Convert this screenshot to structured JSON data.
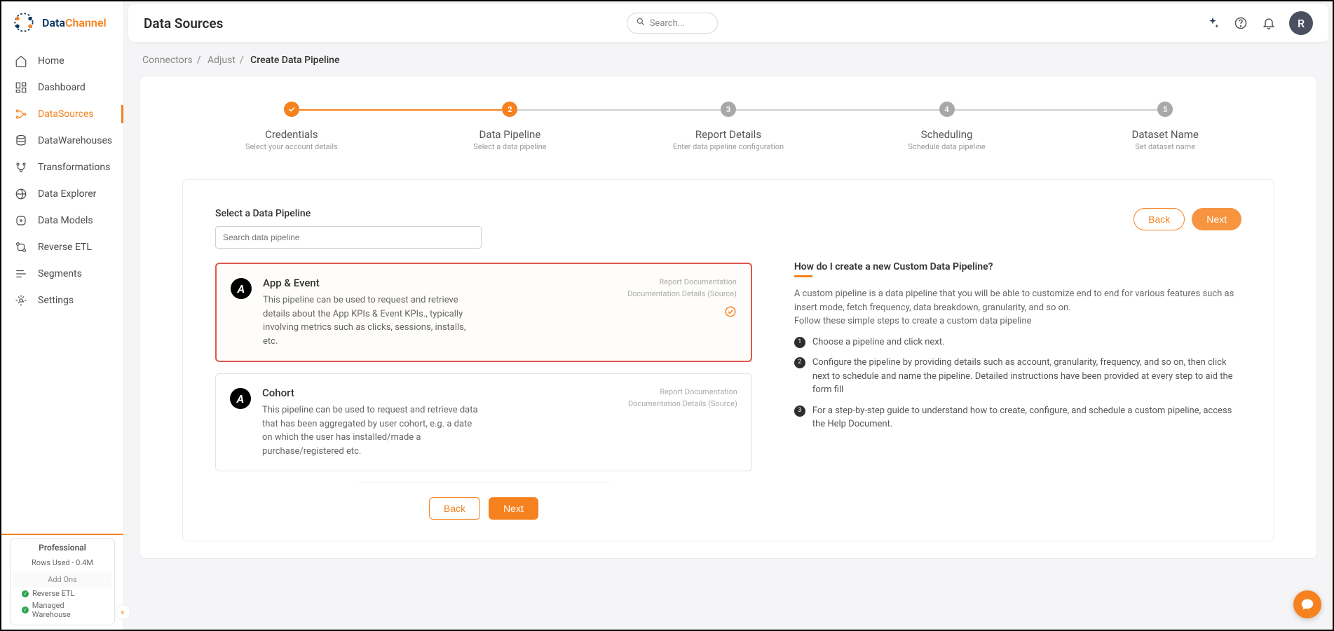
{
  "brand": {
    "name_a": "Data",
    "name_b": "Channel"
  },
  "sidebar": {
    "items": [
      {
        "label": "Home"
      },
      {
        "label": "Dashboard"
      },
      {
        "label": "DataSources"
      },
      {
        "label": "DataWarehouses"
      },
      {
        "label": "Transformations"
      },
      {
        "label": "Data Explorer"
      },
      {
        "label": "Data Models"
      },
      {
        "label": "Reverse ETL"
      },
      {
        "label": "Segments"
      },
      {
        "label": "Settings"
      }
    ],
    "plan": {
      "name": "Professional",
      "rows": "Rows Used - 0.4M",
      "addons_label": "Add Ons",
      "addon1": "Reverse ETL",
      "addon2": "Managed Warehouse"
    }
  },
  "header": {
    "title": "Data Sources",
    "search_placeholder": "Search...",
    "avatar": "R"
  },
  "breadcrumb": {
    "a": "Connectors",
    "b": "Adjust",
    "c": "Create Data Pipeline"
  },
  "steps": [
    {
      "num": "✓",
      "title": "Credentials",
      "sub": "Select your account details"
    },
    {
      "num": "2",
      "title": "Data Pipeline",
      "sub": "Select a data pipeline"
    },
    {
      "num": "3",
      "title": "Report Details",
      "sub": "Enter data pipeline configuration"
    },
    {
      "num": "4",
      "title": "Scheduling",
      "sub": "Schedule data pipeline"
    },
    {
      "num": "5",
      "title": "Dataset Name",
      "sub": "Set dataset name"
    }
  ],
  "section": {
    "label": "Select a Data Pipeline",
    "search_placeholder": "Search data pipeline"
  },
  "actions": {
    "back": "Back",
    "next": "Next"
  },
  "pipelines": [
    {
      "title": "App & Event",
      "desc": "This pipeline can be used to request and retrieve details about the App KPIs & Event KPIs., typically involving metrics such as clicks, sessions, installs, etc.",
      "doc1": "Report Documentation",
      "doc2": "Documentation Details (Source)"
    },
    {
      "title": "Cohort",
      "desc": "This pipeline can be used to request and retrieve data that has been aggregated by user cohort, e.g. a date on which the user has installed/made a purchase/registered etc.",
      "doc1": "Report Documentation",
      "doc2": "Documentation Details (Source)"
    }
  ],
  "help": {
    "title": "How do I create a new Custom Data Pipeline?",
    "intro": "A custom pipeline is a data pipeline that you will be able to customize end to end for various features such as insert mode, fetch frequency, data breakdown, granularity, and so on.",
    "intro2": "Follow these simple steps to create a custom data pipeline",
    "items": [
      "Choose a pipeline and click next.",
      "Configure the pipeline by providing details such as account, granularity, frequency, and so on, then click next to schedule and name the pipeline. Detailed instructions have been provided at every step to aid the form fill",
      "For a step-by-step guide to understand how to create, configure, and schedule a custom pipeline, access the Help Document."
    ]
  }
}
